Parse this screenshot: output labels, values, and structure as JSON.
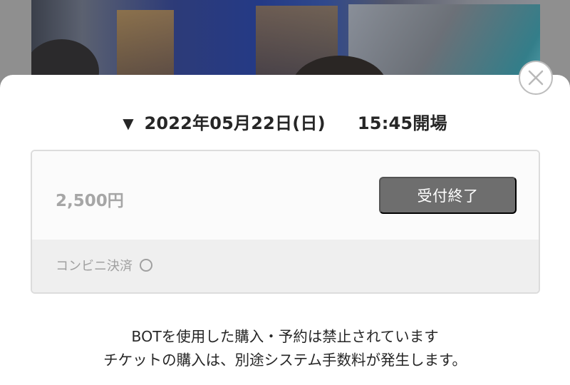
{
  "modal": {
    "date_text": "2022年05月22日(日)",
    "time_text": "15:45開場",
    "arrow": "▼"
  },
  "ticket": {
    "price": "2,500円",
    "status_label": "受付終了",
    "payment_method": "コンビニ決済"
  },
  "notice": {
    "line1": "BOTを使用した購入・予約は禁止されています",
    "line2": "チケットの購入は、別途システム手数料が発生します。"
  },
  "icons": {
    "close": "close-icon",
    "available": "circle-icon"
  },
  "colors": {
    "status_button": "#6e6e6e",
    "price_text": "#a6a6a6",
    "sheet_background": "#ffffff"
  }
}
